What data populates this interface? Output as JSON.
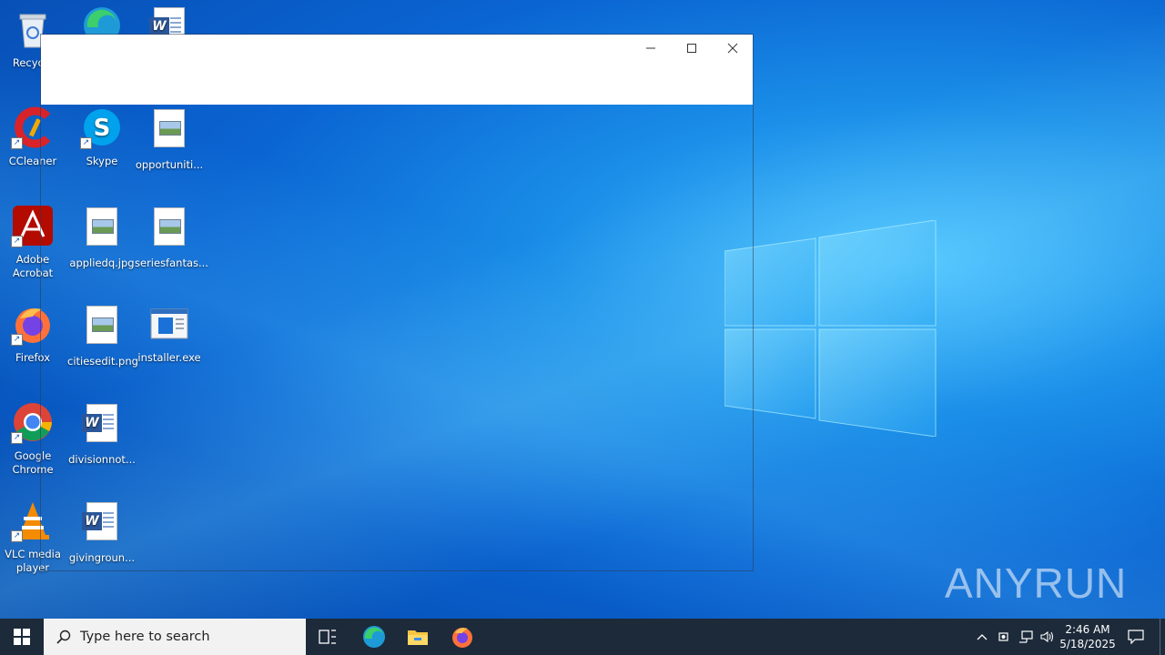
{
  "desktop": {
    "icons": [
      {
        "label": "Recycle",
        "icon": "recycle-bin-icon"
      },
      {
        "label": "",
        "icon": "edge-icon"
      },
      {
        "label": "",
        "icon": "word-doc-icon"
      },
      {
        "label": "CCleaner",
        "icon": "ccleaner-icon"
      },
      {
        "label": "Skype",
        "icon": "skype-icon"
      },
      {
        "label": "opportuniti...",
        "icon": "image-file-icon"
      },
      {
        "label": "Adobe Acrobat",
        "icon": "acrobat-icon"
      },
      {
        "label": "appliedq.jpg",
        "icon": "image-file-icon"
      },
      {
        "label": "seriesfantas...",
        "icon": "image-file-icon"
      },
      {
        "label": "Firefox",
        "icon": "firefox-icon"
      },
      {
        "label": "citiesedit.png",
        "icon": "image-file-icon"
      },
      {
        "label": "installer.exe",
        "icon": "exe-icon"
      },
      {
        "label": "Google Chrome",
        "icon": "chrome-icon"
      },
      {
        "label": "divisionnot...",
        "icon": "word-doc-icon"
      },
      {
        "label": "VLC media player",
        "icon": "vlc-icon"
      },
      {
        "label": "givingroun...",
        "icon": "word-doc-icon"
      }
    ]
  },
  "window": {
    "title": "",
    "buttons": {
      "minimize": "minimize",
      "maximize": "maximize",
      "close": "close"
    }
  },
  "taskbar": {
    "search_placeholder": "Type here to search",
    "pinned": [
      "task-view-icon",
      "edge-icon",
      "file-explorer-icon",
      "firefox-icon"
    ],
    "clock_time": "2:46 AM",
    "clock_date": "5/18/2025"
  },
  "watermark": {
    "text_left": "ANY",
    "text_right": "RUN"
  },
  "colors": {
    "taskbar": "#1c2a3a",
    "desktop_accent": "#0a64d2",
    "word_blue": "#2b579a"
  }
}
